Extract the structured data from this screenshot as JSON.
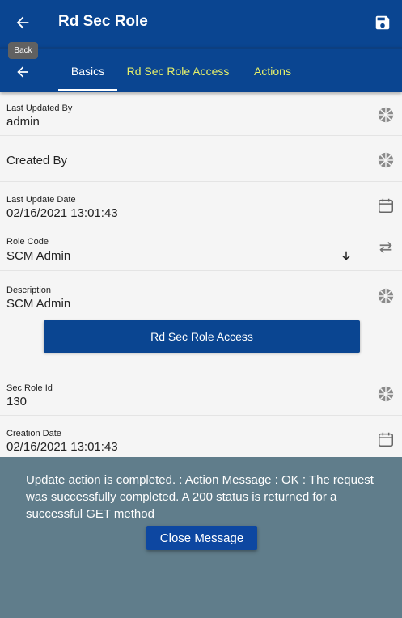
{
  "header": {
    "title": "Rd Sec Role",
    "back_tooltip": "Back",
    "back_icon": "arrow-left-icon",
    "save_icon": "save-icon"
  },
  "tabs": [
    {
      "label": "Basics",
      "active": true
    },
    {
      "label": "Rd Sec Role Access",
      "active": false
    },
    {
      "label": "Actions",
      "active": false
    }
  ],
  "fields": {
    "last_updated_by": {
      "label": "Last Updated By",
      "value": "admin"
    },
    "created_by": {
      "label": "Created By",
      "value": ""
    },
    "last_update_date": {
      "label": "Last Update Date",
      "value": "02/16/2021 13:01:43"
    },
    "role_code": {
      "label": "Role Code",
      "value": "SCM Admin"
    },
    "description": {
      "label": "Description",
      "value": "SCM Admin"
    },
    "sec_role_id": {
      "label": "Sec Role Id",
      "value": "130"
    },
    "creation_date": {
      "label": "Creation Date",
      "value": "02/16/2021 13:01:43"
    }
  },
  "action_button": {
    "label": "Rd Sec Role Access"
  },
  "message": {
    "text": "Update action is completed.  : Action Message : OK : The request was successfully completed. A 200 status is returned for a successful GET method",
    "close_label": "Close Message"
  },
  "colors": {
    "primary": "#0a4591",
    "tab_inactive": "#e6f06a",
    "overlay": "#607d8b"
  }
}
